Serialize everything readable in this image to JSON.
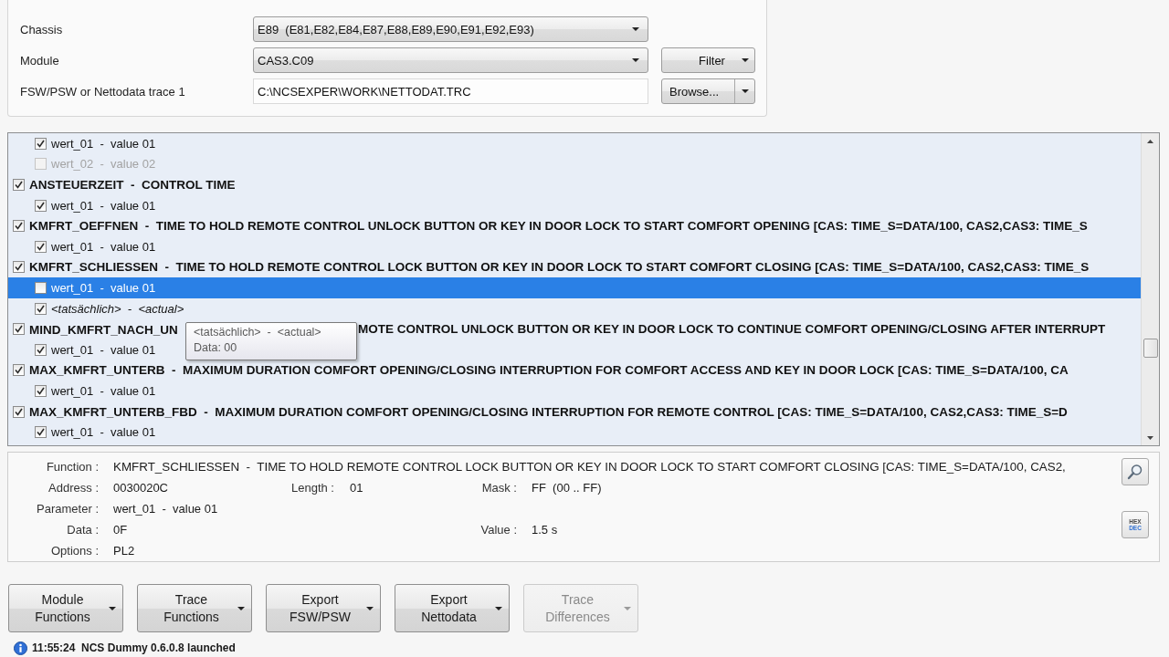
{
  "form": {
    "rows": [
      {
        "kind": "dropdown",
        "label": "Chassis",
        "value": "E89  (E81,E82,E84,E87,E88,E89,E90,E91,E92,E93)"
      },
      {
        "kind": "dropdown",
        "label": "Module",
        "value": "CAS3.C09",
        "button": {
          "kind": "menu",
          "label": "Filter"
        }
      },
      {
        "kind": "text",
        "label": "FSW/PSW or Nettodata trace 1",
        "value": "C:\\NCSEXPER\\WORK\\NETTODAT.TRC",
        "button": {
          "kind": "split",
          "label": "Browse..."
        }
      }
    ]
  },
  "tree": {
    "items": [
      {
        "children": [
          {
            "kind": "value",
            "label": "wert_01  -  value 01",
            "checked": true,
            "selected": false,
            "disabled": false
          },
          {
            "kind": "value",
            "label": "wert_02  -  value 02",
            "checked": false,
            "selected": false,
            "disabled": true
          }
        ]
      },
      {
        "label": "ANSTEUERZEIT  -  CONTROL TIME",
        "checked": true,
        "selected": false,
        "disabled": false,
        "children": [
          {
            "kind": "value",
            "label": "wert_01  -  value 01",
            "checked": true,
            "selected": false,
            "disabled": false
          }
        ]
      },
      {
        "label": "KMFRT_OEFFNEN  -  TIME TO HOLD REMOTE CONTROL UNLOCK BUTTON OR KEY IN DOOR LOCK TO START COMFORT OPENING [CAS: TIME_S=DATA/100, CAS2,CAS3: TIME_S",
        "checked": true,
        "selected": false,
        "disabled": false,
        "children": [
          {
            "kind": "value",
            "label": "wert_01  -  value 01",
            "checked": true,
            "selected": false,
            "disabled": false
          }
        ]
      },
      {
        "label": "KMFRT_SCHLIESSEN  -  TIME TO HOLD REMOTE CONTROL LOCK BUTTON OR KEY IN DOOR LOCK TO START COMFORT CLOSING [CAS: TIME_S=DATA/100, CAS2,CAS3: TIME_S",
        "checked": true,
        "selected": false,
        "disabled": false,
        "children": [
          {
            "kind": "value",
            "label": "wert_01  -  value 01",
            "checked": false,
            "selected": true,
            "disabled": false
          },
          {
            "kind": "actual",
            "label": "<tatsächlich>  -  <actual>",
            "checked": true,
            "selected": false,
            "disabled": false
          }
        ]
      },
      {
        "label_parts": [
          "MIND_KMFRT_NACH_UN",
          "MOTE CONTROL UNLOCK BUTTON OR KEY IN DOOR LOCK TO CONTINUE COMFORT OPENING/CLOSING AFTER INTERRUPT"
        ],
        "checked": true,
        "selected": false,
        "disabled": false,
        "tooltip": {
          "title": "<tatsächlich>  -  <actual>",
          "detail": "Data: 00"
        },
        "children": [
          {
            "kind": "value",
            "label": "wert_01  -  value 01",
            "checked": true,
            "selected": false,
            "disabled": false
          }
        ]
      },
      {
        "label": "MAX_KMFRT_UNTERB  -  MAXIMUM DURATION COMFORT OPENING/CLOSING INTERRUPTION FOR COMFORT ACCESS AND KEY IN DOOR LOCK [CAS: TIME_S=DATA/100, CA",
        "checked": true,
        "selected": false,
        "disabled": false,
        "children": [
          {
            "kind": "value",
            "label": "wert_01  -  value 01",
            "checked": true,
            "selected": false,
            "disabled": false
          }
        ]
      },
      {
        "label": "MAX_KMFRT_UNTERB_FBD  -  MAXIMUM DURATION COMFORT OPENING/CLOSING INTERRUPTION FOR REMOTE CONTROL [CAS: TIME_S=DATA/100, CAS2,CAS3: TIME_S=D",
        "checked": true,
        "selected": false,
        "disabled": false,
        "children": [
          {
            "kind": "value",
            "label": "wert_01  -  value 01",
            "checked": true,
            "selected": false,
            "disabled": false
          }
        ]
      }
    ]
  },
  "details": {
    "function": {
      "label": "Function :",
      "value": "KMFRT_SCHLIESSEN  -  TIME TO HOLD REMOTE CONTROL LOCK BUTTON OR KEY IN DOOR LOCK TO START COMFORT CLOSING [CAS: TIME_S=DATA/100, CAS2,"
    },
    "address": {
      "label": "Address :",
      "value": "0030020C"
    },
    "length": {
      "label": "Length :",
      "value": "01"
    },
    "mask": {
      "label": "Mask :",
      "value": "FF  (00 .. FF)"
    },
    "parameter": {
      "label": "Parameter :",
      "value": "wert_01  -  value 01"
    },
    "data": {
      "label": "Data :",
      "value": "0F"
    },
    "value": {
      "label": "Value :",
      "value": "1.5 s"
    },
    "options": {
      "label": "Options :",
      "value": "PL2"
    },
    "hex_dec": {
      "top": "HEX",
      "bottom": "DEC"
    }
  },
  "actions": [
    {
      "lines": [
        "Module",
        "Functions"
      ],
      "disabled": false
    },
    {
      "lines": [
        "Trace",
        "Functions"
      ],
      "disabled": false
    },
    {
      "lines": [
        "Export",
        "FSW/PSW"
      ],
      "disabled": false
    },
    {
      "lines": [
        "Export",
        "Nettodata"
      ],
      "disabled": false
    },
    {
      "lines": [
        "Trace",
        "Differences"
      ],
      "disabled": true
    }
  ],
  "status_bar": {
    "text": "11:55:24  NCS Dummy 0.6.0.8 launched"
  }
}
